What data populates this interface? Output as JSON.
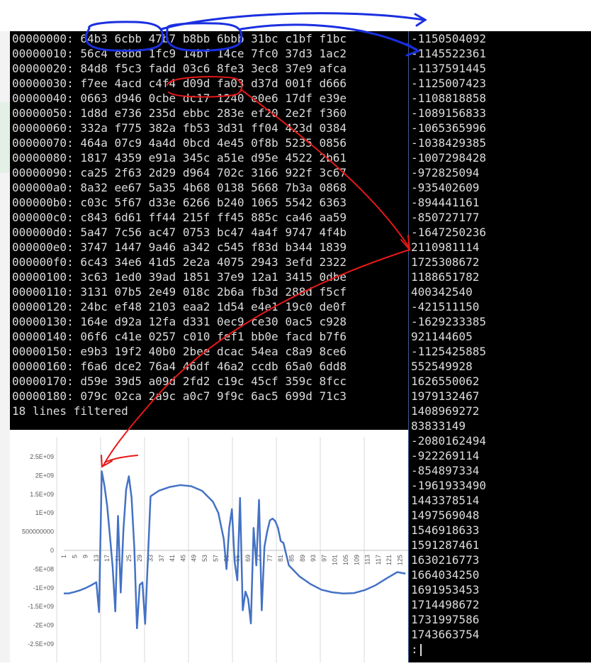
{
  "hex_dump": {
    "lines": [
      "00000000: 64b3 6cbb 47b7 b8bb 6bbb 31bc c1bf f1bc",
      "00000010: 56c4 e8bd 1fc9 14bf 14ce 7fc0 37d3 1ac2",
      "00000020: 84d8 f5c3 fadd 03c6 8fe3 3ec8 37e9 afca",
      "00000030: f7ee 4acd c4f4 d09d fa03 d37d 001f d666",
      "00000040: 0663 d946 0cbe dc17 1240 e0e6 17df e39e",
      "00000050: 1d8d e736 235d ebbc 283e ef20 2e2f f360",
      "00000060: 332a f775 382a fb53 3d31 ff04 423d 0384",
      "00000070: 464a 07c9 4a4d 0bcd 4e45 0f8b 5235 0856",
      "00000080: 1817 4359 e91a 345c a51e d95e 4522 2b61",
      "00000090: ca25 2f63 2d29 d964 702c 3166 922f 3c67",
      "000000a0: 8a32 ee67 5a35 4b68 0138 5668 7b3a 0868",
      "000000b0: c03c 5f67 d33e 6266 b240 1065 5542 6363",
      "000000c0: c843 6d61 ff44 215f ff45 885c ca46 aa59",
      "000000d0: 5a47 7c56 ac47 0753 bc47 4a4f 9747 4f4b",
      "000000e0: 3747 1447 9a46 a342 c545 f83d b344 1839",
      "000000f0: 6c43 34e6 41d5 2e2a 4075 2943 3efd 2322",
      "00000100: 3c63 1ed0 39ad 1851 37e9 12a1 3415 0dbe",
      "00000110: 3131 07b5 2e49 018c 2b6a fb3d 288d f5cf",
      "00000120: 24bc ef48 2103 eaa2 1d54 e4e1 19c0 de0f",
      "00000130: 164e d92a 12fa d331 0ec9 ce30 0ac5 c928",
      "00000140: 06f6 c41e 0257 c010 fef1 bb0e facd b7f6",
      "00000150: e9b3 19f2 40b0 2bee dcac 54ea c8a9 8ce6",
      "00000160: f6a6 dce2 76a4 46df 46a2 ccdb 65a0 6dd8",
      "00000170: d59e 39d5 a09d 2fd2 c19c 45cf 359c 8fcc",
      "00000180: 079c 02ca 2a9c a0c7 9f9c 6ac5 699d 71c3"
    ],
    "status": "18 lines filtered"
  },
  "decimal_output": {
    "values": [
      "-1150504092",
      "-1145522361",
      "-1137591445",
      "-1125007423",
      "-1108818858",
      "-1089156833",
      "-1065365996",
      "-1038429385",
      "-1007298428",
      "-972825094",
      "-935402609",
      "-894441161",
      "-850727177",
      "-1647250236",
      "2110981114",
      "1725308672",
      "1188651782",
      "400342540",
      "-421511150",
      "-1629233385",
      "921144605",
      "-1125425885",
      "552549928",
      "1626550062",
      "1979132467",
      "1408969272",
      "83833149",
      "-2080162494",
      "-922269114",
      "-854897334",
      "-1961933490",
      "1443378514",
      "1497569048",
      "1546918633",
      "1591287461",
      "1630216773",
      "1664034250",
      "1691953453",
      "1714498672",
      "1731997586",
      "1743663754"
    ],
    "prompt": ":"
  },
  "chart_data": {
    "type": "line",
    "y_tick_labels": [
      "2.5E+09",
      "2E+09",
      "1.5E+09",
      "1E+09",
      "500000000",
      "0",
      "-5E+08",
      "-1E+09",
      "-1.5E+09",
      "-2E+09",
      "-2.5E+09"
    ],
    "x_tick_labels": [
      "1",
      "5",
      "9",
      "13",
      "17",
      "21",
      "25",
      "29",
      "33",
      "37",
      "41",
      "45",
      "49",
      "53",
      "57",
      "61",
      "65",
      "69",
      "73",
      "77",
      "81",
      "85",
      "89",
      "93",
      "97",
      "101",
      "105",
      "109",
      "113",
      "117",
      "121",
      "125"
    ],
    "ylim": [
      -2500000000,
      2500000000
    ],
    "xlim": [
      1,
      128
    ],
    "grid": "vertical",
    "series_color": "#4472c4",
    "x": [
      1,
      3,
      5,
      7,
      9,
      11,
      13,
      14,
      15,
      16,
      17,
      18,
      19,
      20,
      21,
      22,
      23,
      24,
      25,
      26,
      27,
      28,
      29,
      30,
      31,
      33,
      36,
      40,
      44,
      48,
      52,
      56,
      58,
      60,
      61,
      62,
      63,
      64,
      65,
      66,
      67,
      68,
      69,
      70,
      71,
      72,
      73,
      74,
      75,
      76,
      77,
      78,
      79,
      80,
      81,
      82,
      84,
      88,
      92,
      96,
      100,
      104,
      108,
      112,
      116,
      120,
      124,
      127
    ],
    "y": [
      -1150504092,
      -1145522361,
      -1108818858,
      -1065365996,
      -1007298428,
      -935402609,
      -850727177,
      -1647250236,
      2110981114,
      1725308672,
      1188651782,
      400342540,
      -421511150,
      -1629233385,
      921144605,
      -1125425885,
      552549928,
      1626550062,
      1979132467,
      1408969272,
      83833149,
      -2080162494,
      -922269114,
      -854897334,
      -1961933490,
      1443378514,
      1591287461,
      1691953453,
      1743663754,
      1714498672,
      1591287461,
      1300000000,
      1000000000,
      300000000,
      -500000000,
      600000000,
      1100000000,
      -300000000,
      -800000000,
      1400000000,
      -1600000000,
      -1100000000,
      -1300000000,
      -1950000000,
      600000000,
      -400000000,
      1350000000,
      -1600000000,
      100000000,
      500000000,
      800000000,
      850000000,
      780000000,
      600000000,
      250000000,
      200000000,
      -400000000,
      -700000000,
      -900000000,
      -1050000000,
      -1120000000,
      -1150000000,
      -1140000000,
      -1060000000,
      -930000000,
      -750000000,
      -580000000,
      -620000000
    ]
  }
}
